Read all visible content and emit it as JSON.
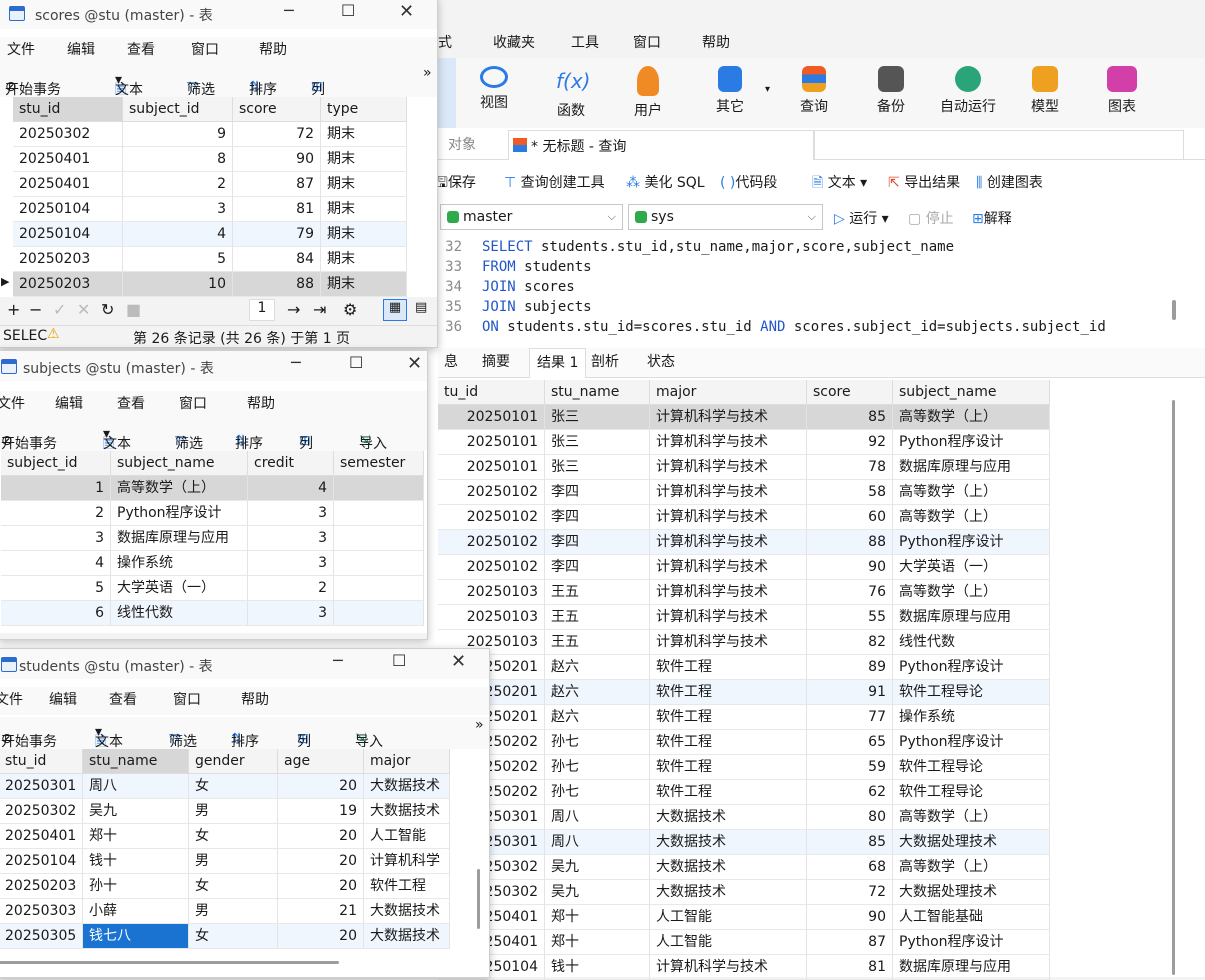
{
  "main": {
    "menu": [
      "式",
      "收藏夹",
      "工具",
      "窗口",
      "帮助"
    ],
    "ribbon": [
      {
        "label": "视图",
        "icon": "view-icon",
        "color": "#2a7be4"
      },
      {
        "label": "函数",
        "icon": "function-icon",
        "color": "#2a7be4"
      },
      {
        "label": "用户",
        "icon": "user-icon",
        "color": "#f08a24"
      },
      {
        "label": "其它",
        "icon": "tools-icon",
        "color": "#2a7be4"
      },
      {
        "label": "查询",
        "icon": "query-icon",
        "color": "#f05a24"
      },
      {
        "label": "备份",
        "icon": "backup-icon",
        "color": "#555555"
      },
      {
        "label": "自动运行",
        "icon": "robot-icon",
        "color": "#2aa57a"
      },
      {
        "label": "模型",
        "icon": "model-icon",
        "color": "#f0a020"
      },
      {
        "label": "图表",
        "icon": "chart-icon",
        "color": "#d23fa8"
      }
    ],
    "object_tab": "对象",
    "query_tab": "* 无标题 - 查询",
    "toolbar": {
      "save": "保存",
      "builder": "查询创建工具",
      "beautify": "美化 SQL",
      "snippet": "代码段",
      "text": "文本",
      "export": "导出结果",
      "create_chart": "创建图表"
    },
    "conn": "master",
    "db": "sys",
    "run": "运行",
    "stop": "停止",
    "explain": "解释",
    "sql": [
      {
        "n": "32",
        "parts": [
          {
            "t": "SELECT",
            "k": true
          },
          {
            "t": " students.stu_id,stu_name,major,score,subject_name",
            "k": false
          }
        ]
      },
      {
        "n": "33",
        "parts": [
          {
            "t": "FROM",
            "k": true
          },
          {
            "t": " students",
            "k": false
          }
        ]
      },
      {
        "n": "34",
        "parts": [
          {
            "t": "JOIN",
            "k": true
          },
          {
            "t": " scores",
            "k": false
          }
        ]
      },
      {
        "n": "35",
        "parts": [
          {
            "t": "JOIN",
            "k": true
          },
          {
            "t": " subjects",
            "k": false
          }
        ]
      },
      {
        "n": "36",
        "parts": [
          {
            "t": "ON",
            "k": true
          },
          {
            "t": " students.stu_id=scores.stu_id ",
            "k": false
          },
          {
            "t": "AND",
            "k": true
          },
          {
            "t": " scores.subject_id=subjects.subject_id",
            "k": false
          }
        ]
      }
    ],
    "result_tabs": [
      "息",
      "摘要",
      "结果 1",
      "剖析",
      "状态"
    ],
    "result_cols": [
      "tu_id",
      "stu_name",
      "major",
      "score",
      "subject_name"
    ],
    "result_rows": [
      [
        "20250101",
        "张三",
        "计算机科学与技术",
        "85",
        "高等数学（上）"
      ],
      [
        "20250101",
        "张三",
        "计算机科学与技术",
        "92",
        "Python程序设计"
      ],
      [
        "20250101",
        "张三",
        "计算机科学与技术",
        "78",
        "数据库原理与应用"
      ],
      [
        "20250102",
        "李四",
        "计算机科学与技术",
        "58",
        "高等数学（上）"
      ],
      [
        "20250102",
        "李四",
        "计算机科学与技术",
        "60",
        "高等数学（上）"
      ],
      [
        "20250102",
        "李四",
        "计算机科学与技术",
        "88",
        "Python程序设计"
      ],
      [
        "20250102",
        "李四",
        "计算机科学与技术",
        "90",
        "大学英语（一）"
      ],
      [
        "20250103",
        "王五",
        "计算机科学与技术",
        "76",
        "高等数学（上）"
      ],
      [
        "20250103",
        "王五",
        "计算机科学与技术",
        "55",
        "数据库原理与应用"
      ],
      [
        "20250103",
        "王五",
        "计算机科学与技术",
        "82",
        "线性代数"
      ],
      [
        "250201",
        "赵六",
        "软件工程",
        "89",
        "Python程序设计"
      ],
      [
        "250201",
        "赵六",
        "软件工程",
        "91",
        "软件工程导论"
      ],
      [
        "250201",
        "赵六",
        "软件工程",
        "77",
        "操作系统"
      ],
      [
        "250202",
        "孙七",
        "软件工程",
        "65",
        "Python程序设计"
      ],
      [
        "250202",
        "孙七",
        "软件工程",
        "59",
        "软件工程导论"
      ],
      [
        "250202",
        "孙七",
        "软件工程",
        "62",
        "软件工程导论"
      ],
      [
        "250301",
        "周八",
        "大数据技术",
        "80",
        "高等数学（上）"
      ],
      [
        "250301",
        "周八",
        "大数据技术",
        "85",
        "大数据处理技术"
      ],
      [
        "250302",
        "吴九",
        "大数据技术",
        "68",
        "高等数学（上）"
      ],
      [
        "250302",
        "吴九",
        "大数据技术",
        "72",
        "大数据处理技术"
      ],
      [
        "250401",
        "郑十",
        "人工智能",
        "90",
        "人工智能基础"
      ],
      [
        "250401",
        "郑十",
        "人工智能",
        "87",
        "Python程序设计"
      ],
      [
        "250104",
        "钱十",
        "计算机科学与技术",
        "81",
        "数据库原理与应用"
      ]
    ]
  },
  "scores_win": {
    "title": "scores @stu (master) - 表",
    "menu": [
      "文件",
      "编辑",
      "查看",
      "窗口",
      "帮助"
    ],
    "tools": {
      "begin": "开始事务",
      "text": "文本",
      "filter": "筛选",
      "sort": "排序",
      "cols": "列"
    },
    "cols": [
      "stu_id",
      "subject_id",
      "score",
      "type"
    ],
    "rows": [
      [
        "20250302",
        "9",
        "72",
        "期末"
      ],
      [
        "20250401",
        "8",
        "90",
        "期末"
      ],
      [
        "20250401",
        "2",
        "87",
        "期末"
      ],
      [
        "20250104",
        "3",
        "81",
        "期末"
      ],
      [
        "20250104",
        "4",
        "79",
        "期末"
      ],
      [
        "20250203",
        "5",
        "84",
        "期末"
      ],
      [
        "20250203",
        "10",
        "88",
        "期末"
      ]
    ],
    "page": "1",
    "status_left": "SELEC",
    "status": "第 26 条记录 (共 26 条) 于第 1 页"
  },
  "subjects_win": {
    "title": "subjects @stu (master) - 表",
    "menu": [
      "文件",
      "编辑",
      "查看",
      "窗口",
      "帮助"
    ],
    "tools": {
      "begin": "开始事务",
      "text": "文本",
      "filter": "筛选",
      "sort": "排序",
      "cols": "列",
      "import": "导入"
    },
    "cols": [
      "subject_id",
      "subject_name",
      "credit",
      "semester"
    ],
    "rows": [
      [
        "1",
        "高等数学（上）",
        "4",
        ""
      ],
      [
        "2",
        "Python程序设计",
        "3",
        ""
      ],
      [
        "3",
        "数据库原理与应用",
        "3",
        ""
      ],
      [
        "4",
        "操作系统",
        "3",
        ""
      ],
      [
        "5",
        "大学英语（一）",
        "2",
        ""
      ],
      [
        "6",
        "线性代数",
        "3",
        ""
      ]
    ]
  },
  "students_win": {
    "title": "students @stu (master) - 表",
    "menu": [
      "文件",
      "编辑",
      "查看",
      "窗口",
      "帮助"
    ],
    "tools": {
      "begin": "开始事务",
      "text": "文本",
      "filter": "筛选",
      "sort": "排序",
      "cols": "列",
      "import": "导入"
    },
    "cols": [
      "stu_id",
      "stu_name",
      "gender",
      "age",
      "major"
    ],
    "rows": [
      [
        "20250301",
        "周八",
        "女",
        "20",
        "大数据技术"
      ],
      [
        "20250302",
        "吴九",
        "男",
        "19",
        "大数据技术"
      ],
      [
        "20250401",
        "郑十",
        "女",
        "20",
        "人工智能"
      ],
      [
        "20250104",
        "钱十",
        "男",
        "20",
        "计算机科学"
      ],
      [
        "20250203",
        "孙十",
        "女",
        "20",
        "软件工程"
      ],
      [
        "20250303",
        "小薛",
        "男",
        "21",
        "大数据技术"
      ],
      [
        "20250305",
        "钱七八",
        "女",
        "20",
        "大数据技术"
      ]
    ]
  }
}
